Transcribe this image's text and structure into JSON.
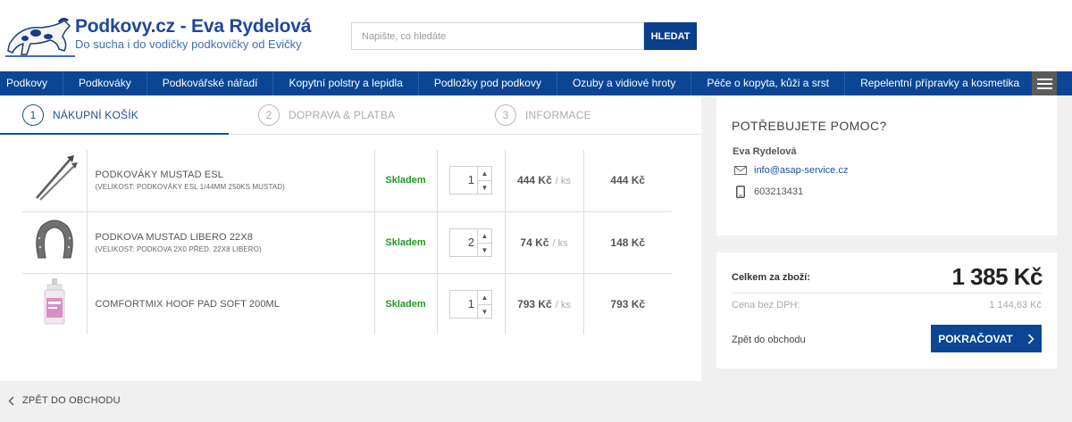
{
  "brand": {
    "title": "Podkovy.cz - Eva Rydelová",
    "subtitle": "Do sucha i do vodičky podkovičky od Evičky"
  },
  "search": {
    "placeholder": "Napište, co hledáte",
    "button": "HLEDAT"
  },
  "nav": {
    "items": [
      "Podkovy",
      "Podkováky",
      "Podkovářské nářadí",
      "Kopytní polstry a lepidla",
      "Podložky pod podkovy",
      "Ozuby a vidiové hroty",
      "Péče o kopyta, kůži a srst",
      "Repelentní přípravky a kosmetika"
    ],
    "menu_icon": "hamburger-icon"
  },
  "steps": [
    {
      "num": "1",
      "label": "NÁKUPNÍ KOŠÍK",
      "active": true
    },
    {
      "num": "2",
      "label": "DOPRAVA & PLATBA",
      "active": false
    },
    {
      "num": "3",
      "label": "INFORMACE",
      "active": false
    }
  ],
  "cart": {
    "items": [
      {
        "name": "PODKOVÁKY MUSTAD ESL",
        "variant": "(VELIKOST: PODKOVÁKY ESL 1/44MM 250KS MUSTAD)",
        "stock": "Skladem",
        "qty": "1",
        "unit_price": "444 Kč",
        "unit": "/ ks",
        "total": "444 Kč",
        "image": "horseshoe-nails-image"
      },
      {
        "name": "PODKOVA MUSTAD LIBERO 22X8",
        "variant": "(VELIKOST: PODKOVA 2X0 PŘED. 22X8 LIBERO)",
        "stock": "Skladem",
        "qty": "2",
        "unit_price": "74 Kč",
        "unit": "/ ks",
        "total": "148 Kč",
        "image": "horseshoe-image"
      },
      {
        "name": "COMFORTMIX HOOF PAD SOFT 200ML",
        "variant": "",
        "stock": "Skladem",
        "qty": "1",
        "unit_price": "793 Kč",
        "unit": "/ ks",
        "total": "793 Kč",
        "image": "cartridge-image"
      }
    ]
  },
  "help": {
    "title": "POTŘEBUJETE POMOC?",
    "name": "Eva Rydelová",
    "email": "info@asap-service.cz",
    "phone": "603213431"
  },
  "summary": {
    "total_label": "Celkem za zboží:",
    "total": "1 385 Kč",
    "net_label": "Cena bez DPH:",
    "net": "1 144,63 Kč",
    "back": "Zpět do obchodu",
    "continue": "POKRAČOVAT"
  },
  "footer": {
    "back": "ZPĚT DO OBCHODU"
  },
  "colors": {
    "brand_blue": "#0b4594",
    "stock_green": "#1f9a24",
    "link_blue": "#1f4f9a"
  }
}
